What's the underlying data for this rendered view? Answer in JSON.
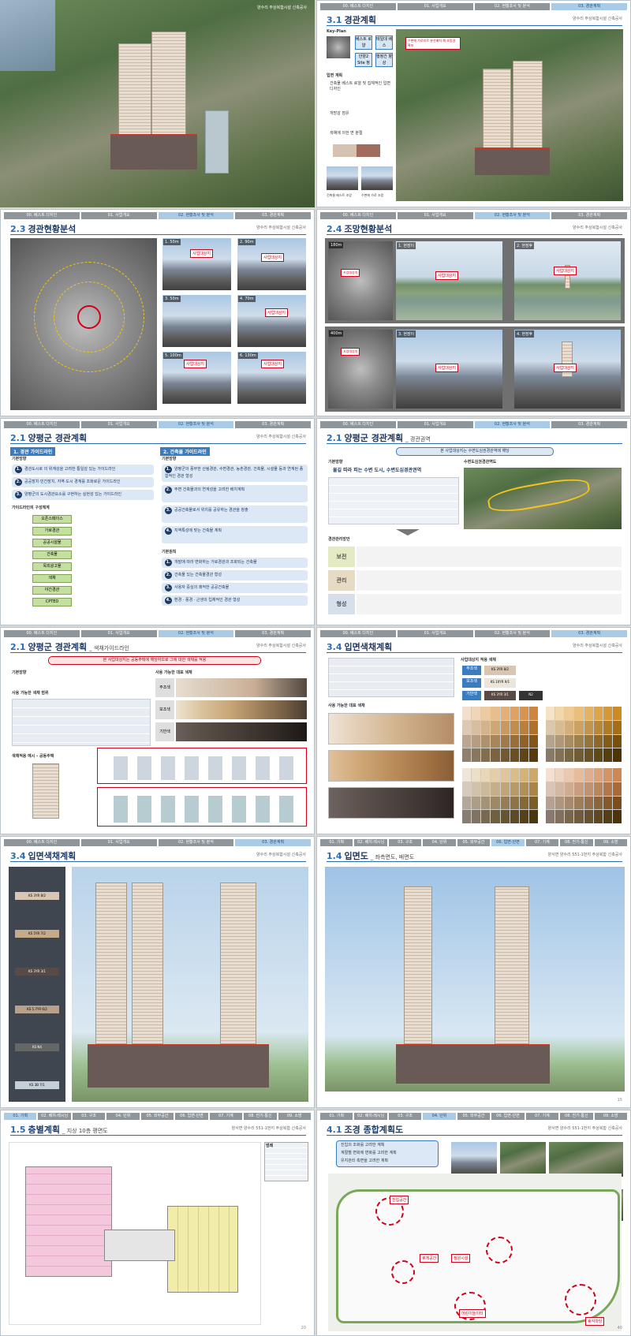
{
  "tabs_a": [
    "00. 베스트 다지인",
    "01. 사업개요",
    "02. 현황조사 및 분석",
    "03. 경관계획"
  ],
  "tabs_b": [
    "01. 기획",
    "02. 배치·레시닝",
    "03. 구조",
    "04. 단위",
    "05. 외부공간",
    "06. 입면·단면",
    "07. 기계",
    "08. 전기·통신",
    "09. 소방"
  ],
  "company": "양수리 주상복합시설 신축공사",
  "company_b": "양서면 양수리 551-1번지 주상복합 신축공사",
  "p1": {
    "tower_label": ""
  },
  "p2": {
    "num": "3.1",
    "title": "경관계획",
    "keyplan": "Key-Plan",
    "boxes": [
      "베스트 로얄",
      "테일데 배스",
      "안양2 Site 정비",
      "행정간 향상"
    ],
    "bullets": [
      "입면 계획",
      "건축물 베스트 로얄 및 집체적인 입면 디자인",
      "개방감 점유",
      "색채에 의한 면 분절"
    ],
    "callout": "수변에 가로지르 분산배치 해 조망권 확보",
    "caption1": "건축물 베스트 조망",
    "caption2": "수변에 가로 조망"
  },
  "p3": {
    "num": "2.3",
    "title": "경관현황분석",
    "thumbs": [
      {
        "n": "1.",
        "d": "50m",
        "m": "사업대상지"
      },
      {
        "n": "2.",
        "d": "90m",
        "m": "사업대상지"
      },
      {
        "n": "3.",
        "d": "50m",
        "m": ""
      },
      {
        "n": "4.",
        "d": "70m",
        "m": "사업대상지"
      },
      {
        "n": "5.",
        "d": "100m",
        "m": "사업대상지"
      },
      {
        "n": "6.",
        "d": "130m",
        "m": "사업대상지"
      }
    ]
  },
  "p4": {
    "num": "2.4",
    "title": "조망현황분석",
    "rows": [
      {
        "d": "180m",
        "l1": "1. 현장이",
        "l2": "2. 현장후"
      },
      {
        "d": "400m",
        "l1": "3. 현장이",
        "l2": "4. 현장후"
      }
    ],
    "marker": "사업대상지"
  },
  "p5": {
    "num": "2.1",
    "title": "양평군 경관계획",
    "sec1": "1. 경관 가이드라인",
    "sec2": "2. 건축물 가이드라인",
    "basic": "기본방향",
    "items": [
      "경관도시로 의 위계성을 고려한 통일감 있는 가이드라인",
      "공공장치·민간장치, 지역·도시 경계를 조화로운 가이드라인",
      "양평군의 도시경관요소를 구현하는 실현성 있는 가이드라인"
    ],
    "structure": "가이드라인의 구성체계",
    "blocks": [
      "오픈스페이스",
      "가로경관",
      "공공시설물",
      "건축물",
      "옥외광고물",
      "색채",
      "야간경관",
      "CPTED"
    ],
    "right_items": [
      "양평군의 풍부한 산림경관, 수변경관, 농촌경관, 건축물, 시설물 등과 연계된 종합적인 경관 형성",
      "주변 건축물과의 연계성을 고려한 배치계획",
      "공공건축물로서 위치를 공유하는 경관을 창출",
      "지역특성에 맞는 건축물 계획"
    ],
    "principle": "기본원칙",
    "principles": [
      "개발에 따라 변화하는 가로경관과 조화되는 건축물",
      "건축물 있는 건축물경관 형성",
      "사용자 중심의 쾌적한 공공건축물",
      "환경 · 풍경 · 근생의 입체적인 경관 형성"
    ]
  },
  "p6": {
    "num": "2.1",
    "title": "양평군 경관계획",
    "sub": "_ 경관권역",
    "banner": "본 사업대상지는 수변도심권경관역에 해당",
    "basic": "기본방향",
    "quote": "물길 따라 피는 수변 도시, 수변도심경관권역",
    "map_title": "수변도심권경관역도",
    "plan": "경관관리방안",
    "rows": [
      "보전",
      "관리",
      "형성"
    ]
  },
  "p7": {
    "num": "2.1",
    "title": "양평군 경관계획",
    "sub": "_ 색채가이드라인",
    "banner": "본 사업대상지는 공동주택에 해당하므로 그에 대한 색채를 적용",
    "basic": "기본방향",
    "range": "사용 가능한 색채 범위",
    "rep": "사용 가능한 대표 색채",
    "rows": [
      "주조색",
      "보조색",
      "기반색"
    ],
    "example": "색채적용 예시 - 공동주택",
    "limits": [
      "명도",
      "채도"
    ]
  },
  "p8": {
    "num": "3.4",
    "title": "입면색채계획",
    "rep": "사용 가능한 대표 색채",
    "plan": "사업대상지 적용 색채",
    "rows": [
      "주조색",
      "보조색",
      "기반색"
    ],
    "chips": [
      "KS 3YR 8/2",
      "KS 10YR 9/1",
      "KS 3YR 3/1",
      "N2"
    ]
  },
  "p9": {
    "num": "3.4",
    "title": "입면색채계획",
    "chips": [
      "KS 3YR 8/2",
      "KS 5YR 7/2",
      "KS 3YR 3/1",
      "KS 5.7YR 6/2",
      "KS N4",
      "KS 3B 7/1"
    ]
  },
  "p10": {
    "num": "1.4",
    "title": "입면도",
    "sub": "_ 좌측면도, 배면도",
    "page": "15"
  },
  "p11": {
    "num": "1.5",
    "title": "층별계획",
    "sub": "_ 지상 10층 평면도",
    "page": "20",
    "legend": "범례"
  },
  "p12": {
    "num": "4.1",
    "title": "조경 종합계획도",
    "points": [
      "진입의 조화를 고려한 계획",
      "계절별 변화에 변화를 고려한 계획",
      "유지관리 측면을 고려한 계획"
    ],
    "spaces": [
      "진입공간",
      "휴게공간",
      "정원시설",
      "어린이놀이터",
      "휴식마당"
    ],
    "page": "40"
  }
}
